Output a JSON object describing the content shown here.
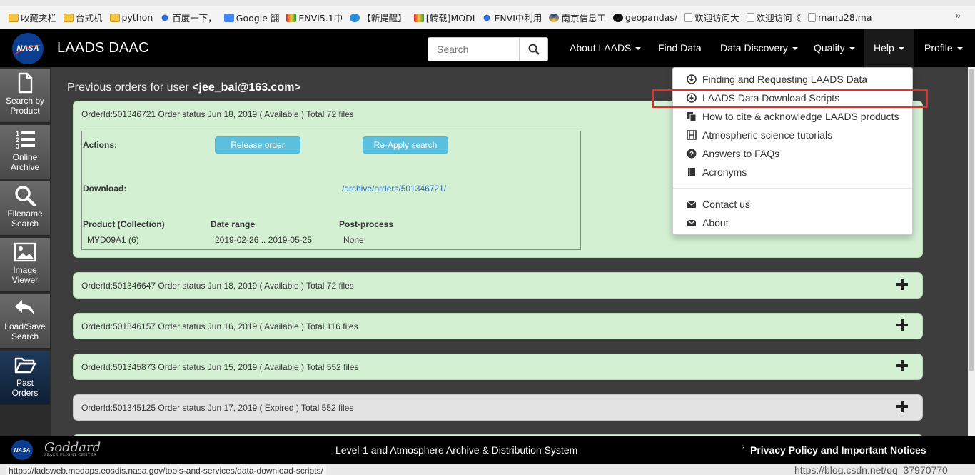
{
  "bookmarks": {
    "items": [
      {
        "label": "收藏夹栏",
        "icon": "folder-icon"
      },
      {
        "label": "台式机",
        "icon": "folder-icon"
      },
      {
        "label": "python",
        "icon": "folder-icon"
      },
      {
        "label": "百度一下，",
        "icon": "baidu-paw-icon"
      },
      {
        "label": "Google 翻",
        "icon": "google-icon"
      },
      {
        "label": "ENVI5.1中",
        "icon": "envi-icon"
      },
      {
        "label": "【新提醒】",
        "icon": "globe-icon"
      },
      {
        "label": "[转载]MODI",
        "icon": "envi-icon"
      },
      {
        "label": "ENVI中利用",
        "icon": "baidu-paw-icon"
      },
      {
        "label": "南京信息工",
        "icon": "nuist-icon"
      },
      {
        "label": "geopandas/",
        "icon": "github-icon"
      },
      {
        "label": "欢迎访问大",
        "icon": "page-icon"
      },
      {
        "label": "欢迎访问《",
        "icon": "page-icon"
      },
      {
        "label": "manu28.ma",
        "icon": "page-icon"
      }
    ],
    "more": "»"
  },
  "navbar": {
    "logo_text": "NASA",
    "title": "LAADS DAAC",
    "search_placeholder": "Search",
    "items": [
      {
        "label": "About LAADS",
        "caret": true
      },
      {
        "label": "Find Data",
        "caret": false
      },
      {
        "label": "Data Discovery",
        "caret": true
      },
      {
        "label": "Quality",
        "caret": true
      },
      {
        "label": "Help",
        "caret": true
      },
      {
        "label": "Profile",
        "caret": true
      }
    ]
  },
  "sidebar": {
    "items": [
      {
        "label1": "Search by",
        "label2": "Product",
        "icon": "document-icon"
      },
      {
        "label1": "Online",
        "label2": "Archive",
        "icon": "numbered-list-icon"
      },
      {
        "label1": "Filename",
        "label2": "Search",
        "icon": "magnifier-icon"
      },
      {
        "label1": "Image",
        "label2": "Viewer",
        "icon": "image-icon"
      },
      {
        "label1": "Load/Save",
        "label2": "Search",
        "icon": "undo-arrow-icon"
      },
      {
        "label1": "Past",
        "label2": "Orders",
        "icon": "folder-open-icon"
      }
    ]
  },
  "main": {
    "heading_prefix": "Previous orders for user ",
    "heading_user": "<jee_bai@163.com>",
    "open_order": {
      "header": "OrderId:501346721 Order status Jun 18, 2019 ( Available ) Total 72 files",
      "actions_label": "Actions:",
      "release_button": "Release order",
      "reapply_button": "Re-Apply search",
      "download_label": "Download:",
      "download_link": "/archive/orders/501346721/",
      "col_product": "Product (Collection)",
      "col_date": "Date range",
      "col_post": "Post-process",
      "product_value": "MYD09A1 (6)",
      "date_value": "2019-02-26 .. 2019-05-25",
      "post_value": "None"
    },
    "orders": [
      {
        "header": "OrderId:501346647 Order status Jun 18, 2019 ( Available ) Total 72 files",
        "expired": false
      },
      {
        "header": "OrderId:501346157 Order status Jun 16, 2019 ( Available ) Total 116 files",
        "expired": false
      },
      {
        "header": "OrderId:501345873 Order status Jun 15, 2019 ( Available ) Total 552 files",
        "expired": false
      },
      {
        "header": "OrderId:501345125 Order status Jun 17, 2019 ( Expired ) Total 552 files",
        "expired": true
      }
    ]
  },
  "help_menu": {
    "items": [
      {
        "label": "Finding and Requesting LAADS Data",
        "icon": "download-circle-icon"
      },
      {
        "label": "LAADS Data Download Scripts",
        "icon": "download-circle-icon"
      },
      {
        "label": "How to cite & acknowledge LAADS products",
        "icon": "copy-docs-icon"
      },
      {
        "label": "Atmospheric science tutorials",
        "icon": "film-icon"
      },
      {
        "label": "Answers to FAQs",
        "icon": "question-circle-icon"
      },
      {
        "label": "Acronyms",
        "icon": "book-icon"
      },
      {
        "label": "Contact us",
        "icon": "envelope-icon"
      },
      {
        "label": "About",
        "icon": "envelope-icon"
      }
    ]
  },
  "footer": {
    "nasa_text": "NASA",
    "goddard_text": "Goddard",
    "goddard_sub": "SPACE FLIGHT CENTER",
    "center_text": "Level-1 and Atmosphere Archive & Distribution System",
    "right_caret": "›",
    "right_text": "Privacy Policy and Important Notices"
  },
  "statusbar": {
    "url": "https://ladsweb.modaps.eosdis.nasa.gov/tools-and-services/data-download-scripts/",
    "watermark": "https://blog.csdn.net/qq_37970770"
  },
  "colors": {
    "highlight": "#e0302a",
    "order_available": "#d3f0d3",
    "order_expired": "#e3e3e3",
    "button_info": "#5bc0de",
    "navbar": "#000000",
    "link": "#2a6ab8"
  }
}
